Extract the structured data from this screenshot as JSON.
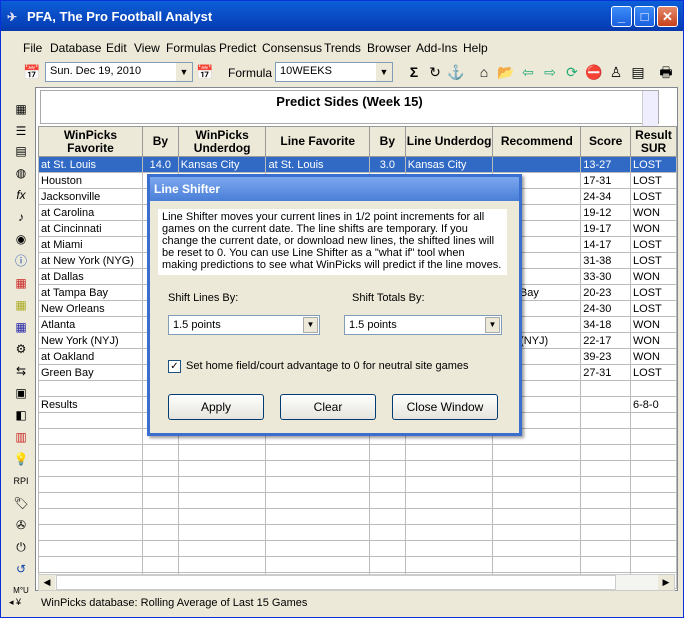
{
  "window": {
    "title": "PFA,  The Pro Football Analyst"
  },
  "menu": [
    "File",
    "Database",
    "Edit",
    "View",
    "Formulas",
    "Predict",
    "Consensus",
    "Trends",
    "Browser",
    "Add-Ins",
    "Help"
  ],
  "toolbar": {
    "date": "Sun. Dec 19, 2010",
    "formula_label": "Formula",
    "formula_value": "10WEEKS"
  },
  "report": {
    "title": "Predict Sides (Week 15)"
  },
  "columns": [
    "WinPicks Favorite",
    "By",
    "WinPicks Underdog",
    "Line Favorite",
    "By",
    "Line Underdog",
    "Recommend",
    "Score",
    "Result SUR"
  ],
  "rows": [
    [
      "at St. Louis",
      "14.0",
      "Kansas City",
      "at St. Louis",
      "3.0",
      "Kansas City",
      "",
      "13-27",
      "LOST"
    ],
    [
      "Houston",
      "",
      "",
      "",
      "",
      "",
      "",
      "17-31",
      "LOST"
    ],
    [
      "Jacksonville",
      "",
      "",
      "",
      "",
      "",
      "",
      "24-34",
      "LOST"
    ],
    [
      "at Carolina",
      "",
      "",
      "",
      "",
      "",
      "",
      "19-12",
      "WON"
    ],
    [
      "at Cincinnati",
      "",
      "",
      "",
      "",
      "",
      "",
      "19-17",
      "WON"
    ],
    [
      "at Miami",
      "",
      "",
      "",
      "",
      "",
      "",
      "14-17",
      "LOST"
    ],
    [
      "at New York (NYG)",
      "",
      "",
      "",
      "",
      "",
      "",
      "31-38",
      "LOST"
    ],
    [
      "at Dallas",
      "",
      "",
      "",
      "",
      "",
      "",
      "33-30",
      "WON"
    ],
    [
      "at Tampa Bay",
      "",
      "",
      "",
      "",
      "",
      "mpa Bay",
      "20-23",
      "LOST"
    ],
    [
      "New Orleans",
      "",
      "",
      "",
      "",
      "",
      "",
      "24-30",
      "LOST"
    ],
    [
      "Atlanta",
      "",
      "",
      "",
      "",
      "",
      "",
      "34-18",
      "WON"
    ],
    [
      "New York (NYJ)",
      "",
      "",
      "",
      "",
      "",
      "York (NYJ)",
      "22-17",
      "WON"
    ],
    [
      "at Oakland",
      "",
      "",
      "",
      "",
      "",
      "",
      "39-23",
      "WON"
    ],
    [
      "Green Bay",
      "",
      "",
      "",
      "",
      "",
      "",
      "27-31",
      "LOST"
    ],
    [
      "",
      "",
      "",
      "",
      "",
      "",
      "",
      "",
      ""
    ],
    [
      "Results",
      "",
      "",
      "",
      "",
      "",
      "",
      "",
      "6-8-0"
    ]
  ],
  "status": {
    "text": "WinPicks database:  Rolling Average of Last 15 Games"
  },
  "dialog": {
    "title": "Line Shifter",
    "message": "Line Shifter moves your current lines in 1/2 point increments for all games on the current date.    The line shifts are temporary.   If you change the current date, or download new lines, the shifted lines will be reset to 0.  You can use Line Shifter as a \"what if\" tool when making predictions to see what WinPicks will predict  if the line moves.",
    "shift_lines_label": "Shift Lines By:",
    "shift_lines_value": "1.5 points",
    "shift_totals_label": "Shift Totals By:",
    "shift_totals_value": "1.5 points",
    "checkbox_label": "Set home field/court advantage to 0 for neutral site games",
    "checkbox_checked": true,
    "apply": "Apply",
    "clear": "Clear",
    "close": "Close Window"
  }
}
